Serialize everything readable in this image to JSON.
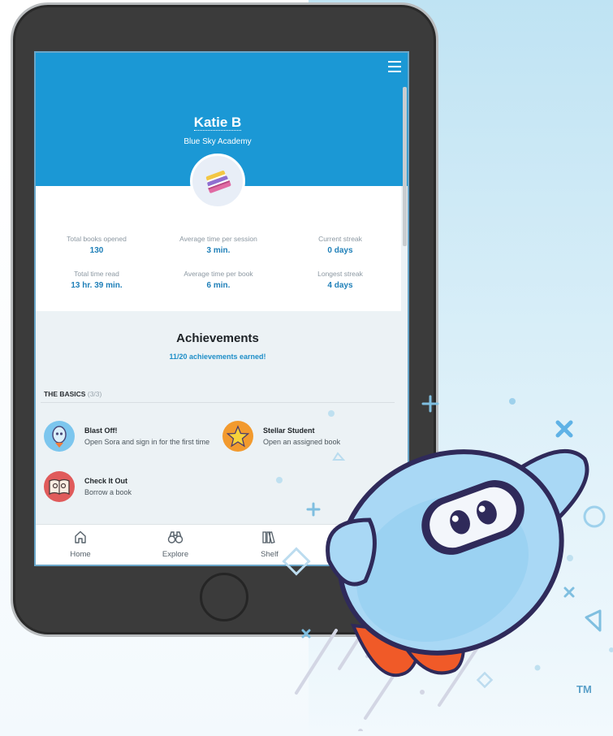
{
  "header": {
    "name": "Katie B",
    "school": "Blue Sky Academy"
  },
  "stats": [
    {
      "label": "Total books opened",
      "value": "130"
    },
    {
      "label": "Average time per session",
      "value": "3 min."
    },
    {
      "label": "Current streak",
      "value": "0 days"
    },
    {
      "label": "Total time read",
      "value": "13 hr. 39 min."
    },
    {
      "label": "Average time per book",
      "value": "6 min."
    },
    {
      "label": "Longest streak",
      "value": "4 days"
    }
  ],
  "achievements": {
    "title": "Achievements",
    "earned": "11/20 achievements earned!",
    "section": {
      "name": "THE BASICS",
      "count": "(3/3)"
    },
    "items": [
      {
        "name": "Blast Off!",
        "desc": "Open Sora and sign in for the first time"
      },
      {
        "name": "Stellar Student",
        "desc": "Open an assigned book"
      },
      {
        "name": "Check It Out",
        "desc": "Borrow a book"
      }
    ]
  },
  "nav": [
    {
      "label": "Home",
      "icon": "home-icon"
    },
    {
      "label": "Explore",
      "icon": "binoculars-icon"
    },
    {
      "label": "Shelf",
      "icon": "books-icon"
    }
  ],
  "trademark": "TM",
  "colors": {
    "header": "#1b98d5",
    "accent": "#1e7fb8",
    "mascot": "#a9d8f5"
  }
}
